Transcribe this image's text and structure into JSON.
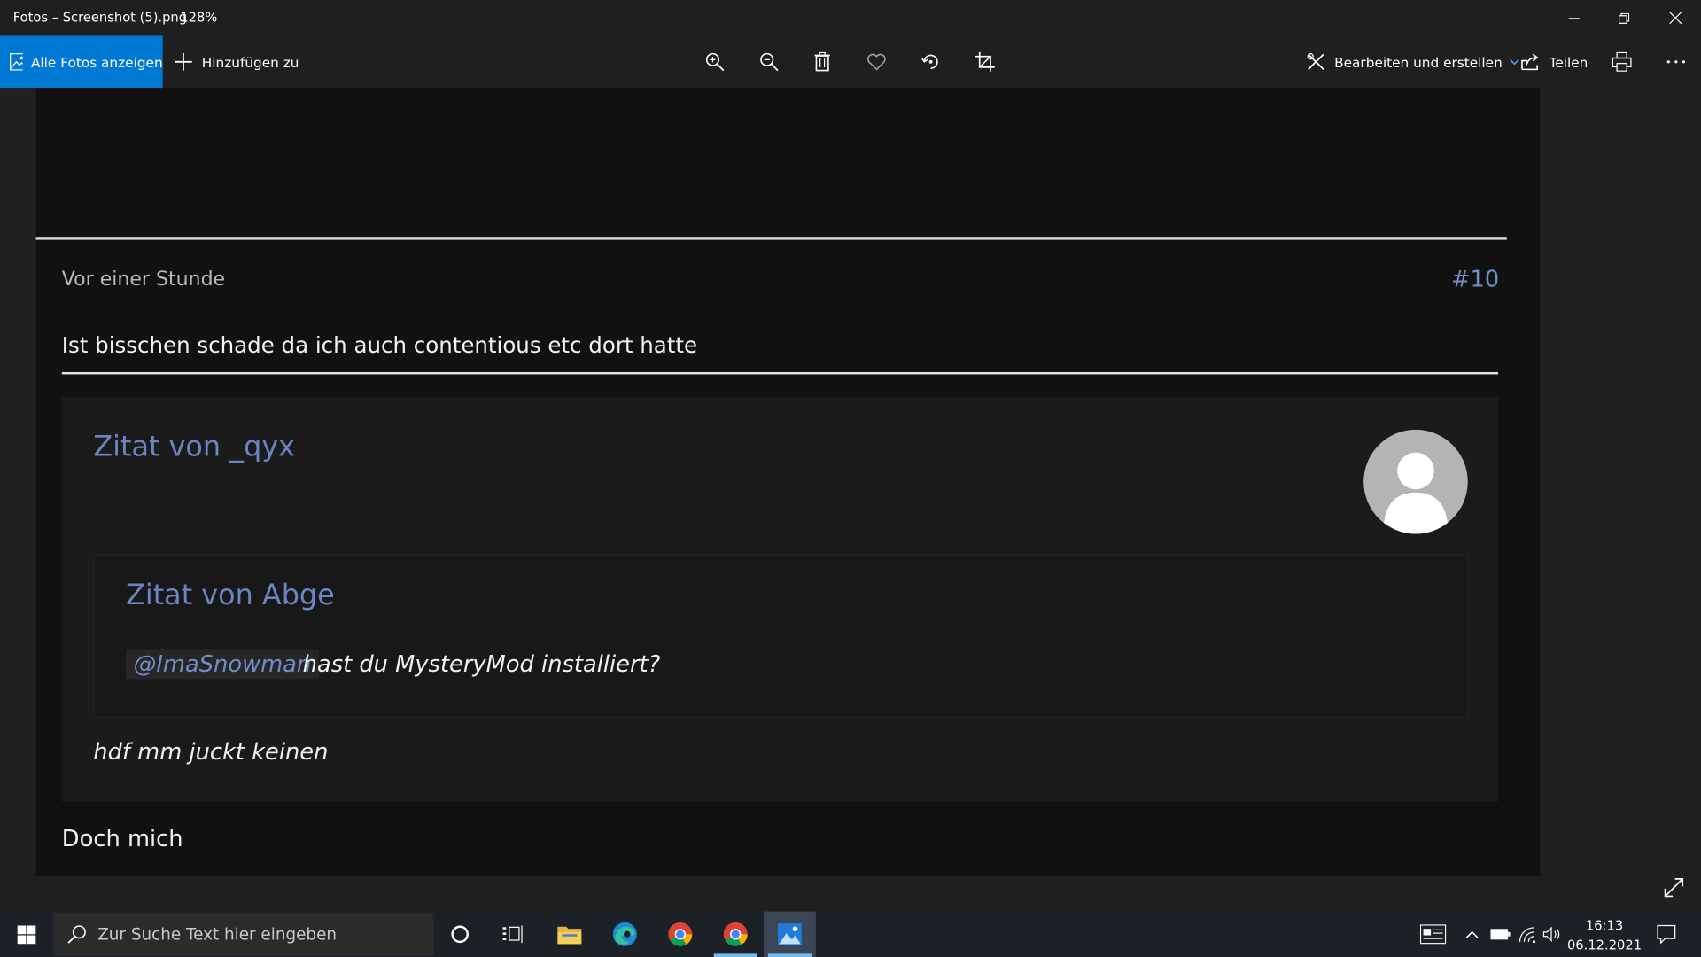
{
  "window": {
    "title": "Fotos – Screenshot (5).png",
    "zoom": "128%"
  },
  "toolbar": {
    "all_photos_label": "Alle Fotos anzeigen",
    "add_to_label": "Hinzufügen zu",
    "edit_create_label": "Bearbeiten und erstellen",
    "share_label": "Teilen",
    "accent_color": "#0078d4"
  },
  "photo": {
    "post_time": "Vor einer Stunde",
    "post_number": "#10",
    "post_text": "Ist bisschen schade da ich auch contentious etc dort hatte",
    "outer_quote_title": "Zitat von _qyx",
    "inner_quote_title": "Zitat von Abge",
    "mention": "@ImaSnowman",
    "inner_quote_text": "hast du MysteryMod installiert?",
    "outer_quote_text": "hdf mm juckt keinen",
    "reply_text": "Doch mich",
    "link_color": "#6a85c2"
  },
  "taskbar": {
    "search_placeholder": "Zur Suche Text hier eingeben",
    "time": "16:13",
    "date": "06.12.2021"
  }
}
